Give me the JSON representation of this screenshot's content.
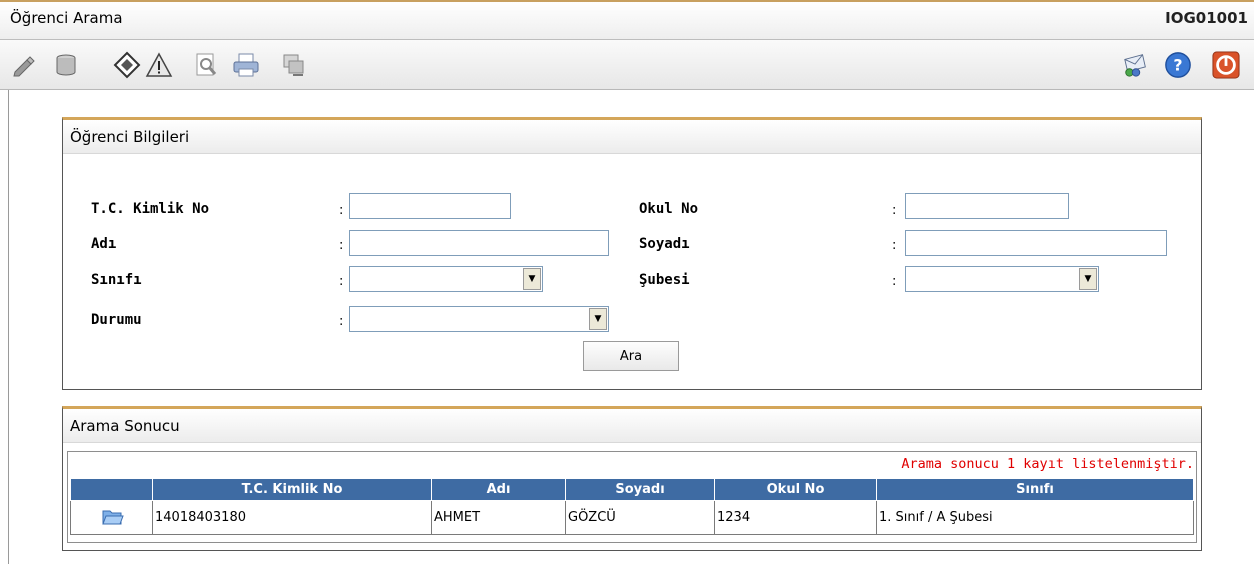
{
  "header": {
    "title": "Öğrenci Arama",
    "code": "IOG01001"
  },
  "toolbar": {
    "left_icons": [
      "pencil-icon",
      "database-icon",
      "tag-icon",
      "warning-icon",
      "search-document-icon",
      "printer-icon",
      "export-icon"
    ],
    "right_icons": [
      "messages-icon",
      "help-icon",
      "power-icon"
    ]
  },
  "form": {
    "panel_title": "Öğrenci Bilgileri",
    "tc_label": "T.C. Kimlik No",
    "okulno_label": "Okul No",
    "adi_label": "Adı",
    "soyadi_label": "Soyadı",
    "sinifi_label": "Sınıfı",
    "subesi_label": "Şubesi",
    "durumu_label": "Durumu",
    "colon": ":",
    "tc_value": "",
    "okulno_value": "",
    "adi_value": "",
    "soyadi_value": "",
    "sinifi_value": "",
    "subesi_value": "",
    "durumu_value": "",
    "search_button": "Ara"
  },
  "results": {
    "panel_title": "Arama Sonucu",
    "message": "Arama sonucu 1 kayıt listelenmiştir.",
    "columns": [
      "",
      "T.C. Kimlik No",
      "Adı",
      "Soyadı",
      "Okul No",
      "Sınıfı"
    ],
    "rows": [
      {
        "tc": "14018403180",
        "adi": "AHMET",
        "soyadi": "GÖZCÜ",
        "okulno": "1234",
        "sinifi": "1. Sınıf / A Şubesi"
      }
    ]
  },
  "colors": {
    "accent": "#d4a65a",
    "header_bg": "#3e6ba3",
    "message": "#e00000"
  }
}
